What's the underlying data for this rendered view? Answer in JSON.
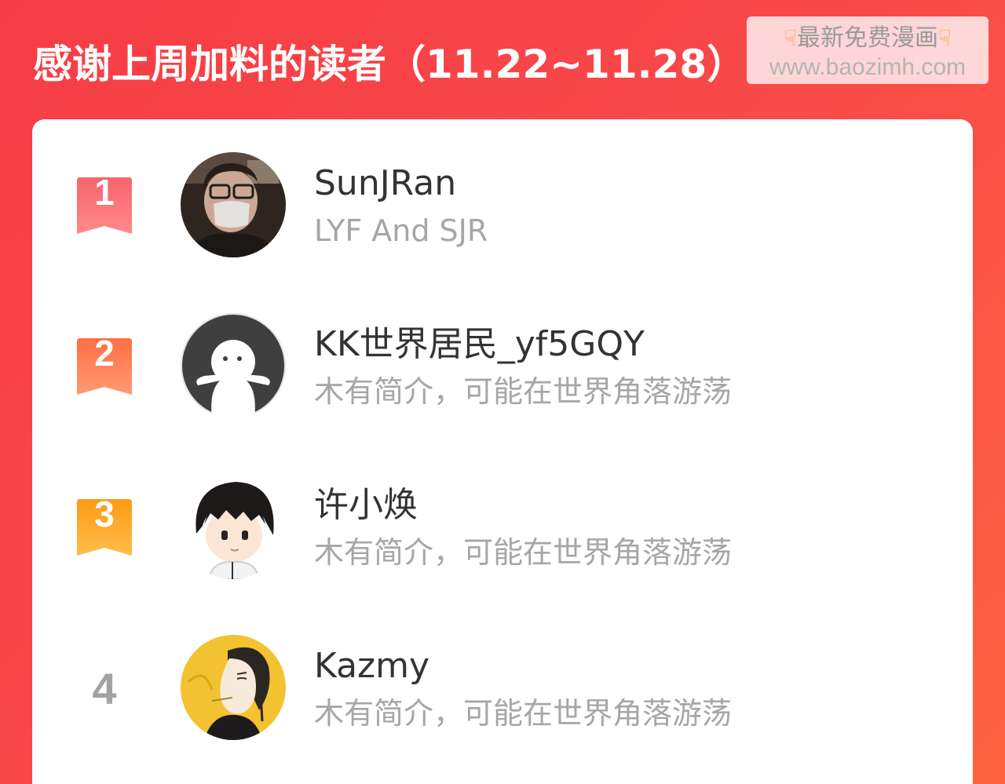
{
  "header": {
    "title": "感谢上周加料的读者（11.22~11.28）"
  },
  "watermark": {
    "line1": "最新免费漫画",
    "line2": "www.baozimh.com",
    "icon": "pointing-down-hand-icon"
  },
  "readers": [
    {
      "rank": "1",
      "name": "SunJRan",
      "bio": "LYF And SJR",
      "badge_color": "#f45a63"
    },
    {
      "rank": "2",
      "name": "KK世界居民_yf5GQY",
      "bio": "木有简介，可能在世界角落游荡",
      "badge_color": "#ff7a4f"
    },
    {
      "rank": "3",
      "name": "许小焕",
      "bio": "木有简介，可能在世界角落游荡",
      "badge_color": "#ffa21f"
    },
    {
      "rank": "4",
      "name": "Kazmy",
      "bio": "木有简介，可能在世界角落游荡"
    }
  ],
  "colors": {
    "background": "#f8484a",
    "card": "#ffffff",
    "name_text": "#333333",
    "bio_text": "#a6a6a6",
    "rank_plain": "#a3a3a3"
  }
}
